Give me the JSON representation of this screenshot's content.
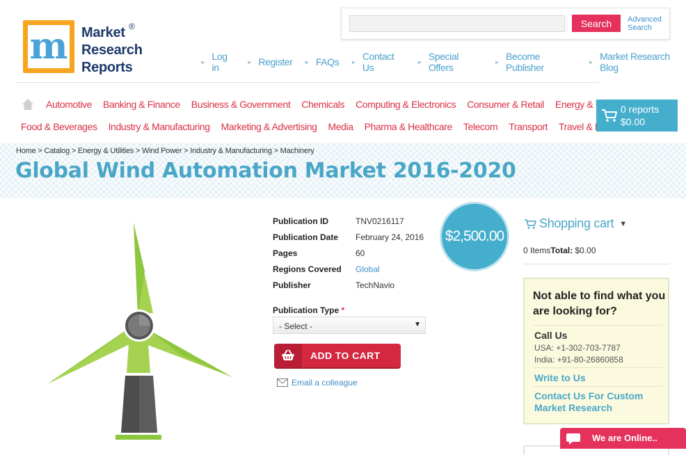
{
  "header": {
    "logo_line1": "Market",
    "logo_line2": "Research",
    "logo_line3": "Reports",
    "logo_reg": "®",
    "search_placeholder": "",
    "search_button": "Search",
    "advanced_search_line1": "Advanced",
    "advanced_search_line2": "Search",
    "top_links": [
      "Log in",
      "Register",
      "FAQs",
      "Contact Us",
      "Special Offers",
      "Become Publisher",
      "Market Research Blog"
    ]
  },
  "nav": {
    "row1": [
      "Automotive",
      "Banking & Finance",
      "Business & Government",
      "Chemicals",
      "Computing & Electronics",
      "Consumer & Retail",
      "Energy & Utilities"
    ],
    "row2": [
      "Food & Beverages",
      "Industry & Manufacturing",
      "Marketing & Advertising",
      "Media",
      "Pharma & Healthcare",
      "Telecom",
      "Transport",
      "Travel & Leisure"
    ]
  },
  "cart_widget": {
    "count": "0 reports",
    "total": "$0.00"
  },
  "breadcrumb": "Home > Catalog > Energy & Utilities > Wind Power > Industry & Manufacturing > Machinery",
  "page_title": "Global Wind Automation Market 2016-2020",
  "product": {
    "details": [
      {
        "label": "Publication ID",
        "value": "TNV0216117"
      },
      {
        "label": "Publication Date",
        "value": "February 24, 2016"
      },
      {
        "label": "Pages",
        "value": "60"
      },
      {
        "label": "Regions Covered",
        "value": "Global"
      },
      {
        "label": "Publisher",
        "value": "TechNavio"
      }
    ],
    "price": "$2,500.00",
    "pub_type_label": "Publication Type",
    "pub_type_required": "*",
    "pub_type_selected": "- Select -",
    "add_to_cart": "ADD TO CART",
    "email_colleague": "Email a colleague"
  },
  "sidebar": {
    "shopping_cart_title": "Shopping cart",
    "items_label": "0 Items",
    "total_label": "Total:",
    "total_value": "$0.00",
    "help_question": "Not able to find what you are looking for?",
    "call_us": "Call Us",
    "phone_usa": "USA: +1-302-703-7787",
    "phone_india": "India: +91-80-26860858",
    "write_to_us": "Write to Us",
    "custom_research": "Contact Us For Custom Market Research"
  },
  "chat": {
    "label": "We are Online.."
  },
  "colors": {
    "accent_red": "#e4325c",
    "accent_blue": "#44aecc",
    "nav_red": "#d93145"
  }
}
